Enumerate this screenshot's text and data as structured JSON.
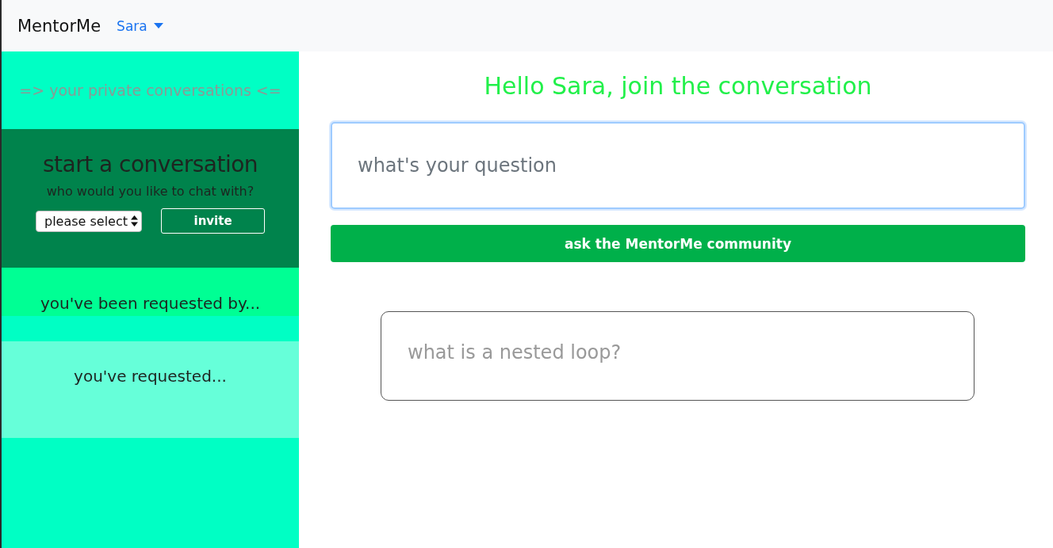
{
  "navbar": {
    "brand": "MentorMe",
    "user_menu": "Sara"
  },
  "sidebar": {
    "heading": "=> your private conversations <=",
    "start": {
      "title": "start a conversation",
      "prompt": "who would you like to chat with?",
      "select": "please select",
      "button": "invite"
    },
    "requested_by": "you've been requested by...",
    "requested": "you've requested..."
  },
  "main": {
    "greeting": "Hello Sara, join the conversation",
    "question_field": {
      "placeholder": "what's your question"
    },
    "button": "ask the MentorMe community",
    "questions": [
      {
        "text": "what is a nested loop?"
      }
    ]
  }
}
